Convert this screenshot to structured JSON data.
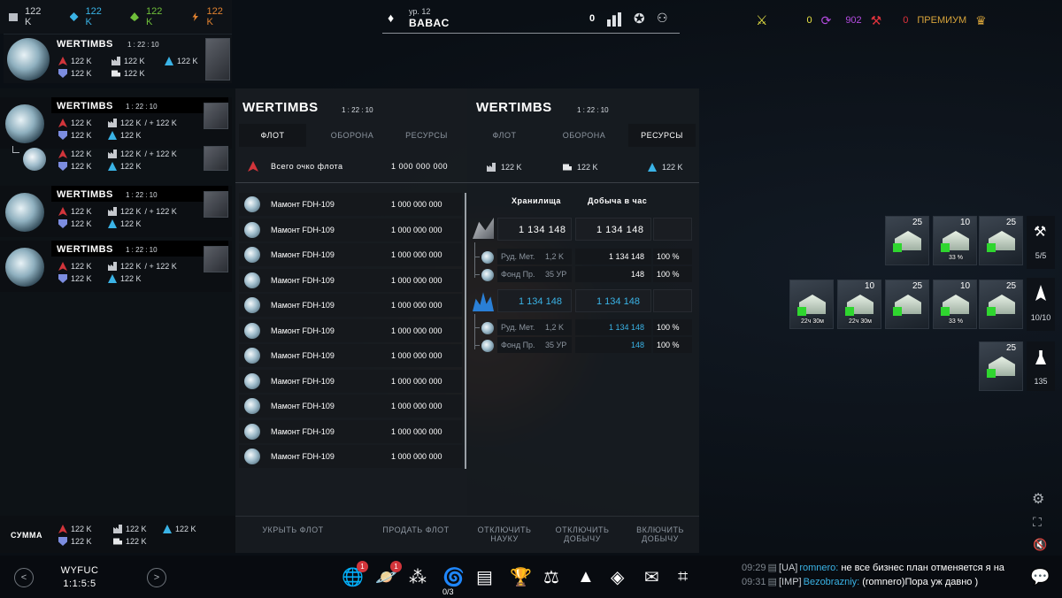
{
  "top_resources": [
    {
      "icon": "storage-icon",
      "value": "122 K",
      "color": "#c6c9ce"
    },
    {
      "icon": "crystal-icon",
      "value": "122 K",
      "color": "#3ab3e6"
    },
    {
      "icon": "deuterium-icon",
      "value": "122 K",
      "color": "#6fbf3a"
    },
    {
      "icon": "energy-icon",
      "value": "122 K",
      "color": "#e0812f"
    }
  ],
  "player": {
    "level": "ур. 12",
    "name": "BABAC",
    "rank": "0"
  },
  "top_right": {
    "val1": "0",
    "val2": "902",
    "val3": "0",
    "premium": "ПРЕМИУМ"
  },
  "planet_card_top": {
    "name": "WERTIMBS",
    "time": "1 : 22 : 10",
    "r1": "122 K",
    "r2": "122 K",
    "r3": "122 K",
    "r4": "122 K",
    "r5": "122 K"
  },
  "planet_list": [
    {
      "name": "WERTIMBS",
      "time": "1 : 22 : 10",
      "a": "122 K",
      "b": "122 K",
      "b_plus": "/ + 122 K",
      "c": "122 K",
      "d": "122 K"
    },
    {
      "name": "",
      "time": "",
      "a": "122 K",
      "b": "122 K",
      "b_plus": "/ + 122 K",
      "c": "122 K",
      "d": "122 K"
    },
    {
      "name": "WERTIMBS",
      "time": "1 : 22 : 10",
      "a": "122 K",
      "b": "122 K",
      "b_plus": "/ + 122 K",
      "c": "122 K",
      "d": "122 K"
    },
    {
      "name": "WERTIMBS",
      "time": "1 : 22 : 10",
      "a": "122 K",
      "b": "122 K",
      "b_plus": "/ + 122 K",
      "c": "122 K",
      "d": "122 K"
    }
  ],
  "sum": {
    "label": "СУММА",
    "a": "122 K",
    "b": "122 K",
    "c": "122 K",
    "d": "122 K",
    "e": "122 K"
  },
  "fleet_panel": {
    "title": "WERTIMBS",
    "time": "1 : 22 : 10",
    "tabs": [
      "ФЛОТ",
      "ОБОРОНА",
      "РЕСУРСЫ"
    ],
    "total_label": "Всего очко флота",
    "total_value": "1 000 000 000",
    "ships": [
      {
        "name": "Мамонт FDH-109",
        "value": "1 000 000 000"
      },
      {
        "name": "Мамонт FDH-109",
        "value": "1 000 000 000"
      },
      {
        "name": "Мамонт FDH-109",
        "value": "1 000 000 000"
      },
      {
        "name": "Мамонт FDH-109",
        "value": "1 000 000 000"
      },
      {
        "name": "Мамонт FDH-109",
        "value": "1 000 000 000"
      },
      {
        "name": "Мамонт FDH-109",
        "value": "1 000 000 000"
      },
      {
        "name": "Мамонт FDH-109",
        "value": "1 000 000 000"
      },
      {
        "name": "Мамонт FDH-109",
        "value": "1 000 000 000"
      },
      {
        "name": "Мамонт FDH-109",
        "value": "1 000 000 000"
      },
      {
        "name": "Мамонт FDH-109",
        "value": "1 000 000 000"
      },
      {
        "name": "Мамонт FDH-109",
        "value": "1 000 000 000"
      }
    ]
  },
  "res_panel": {
    "title": "WERTIMBS",
    "time": "1 : 22 : 10",
    "tabs": [
      "ФЛОТ",
      "ОБОРОНА",
      "РЕСУРСЫ"
    ],
    "sum1": "122 K",
    "sum2": "122 K",
    "sum3": "122 K",
    "col1": "Хранилища",
    "col2": "Добыча в час",
    "metal": {
      "storage": "1 134 148",
      "prod": "1 134 148",
      "rows": [
        {
          "label": "Руд. Мет.",
          "level": "1,2 K",
          "val": "1 134 148",
          "pct": "100 %"
        },
        {
          "label": "Фонд Пр.",
          "level": "35 УР",
          "val": "148",
          "pct": "100 %"
        }
      ]
    },
    "crystal": {
      "storage": "1 134 148",
      "prod": "1 134 148",
      "rows": [
        {
          "label": "Руд. Мет.",
          "level": "1,2 K",
          "val": "1 134 148",
          "pct": "100 %"
        },
        {
          "label": "Фонд Пр.",
          "level": "35 УР",
          "val": "148",
          "pct": "100 %"
        }
      ]
    }
  },
  "bottom_buttons": [
    "УКРЫТЬ ФЛОТ",
    "ПРОДАТЬ ФЛОТ",
    "ОТКЛЮЧИТЬ НАУКУ",
    "ОТКЛЮЧИТЬ ДОБЫЧУ",
    "ВКЛЮЧИТЬ ДОБЫЧУ"
  ],
  "nav": {
    "name": "WYFUC",
    "coords": "1:1:5:5",
    "prev": "<",
    "next": ">"
  },
  "dock": {
    "badge1": "1",
    "badge2": "1",
    "counter": "0/3"
  },
  "chat": [
    {
      "time": "09:29",
      "tag": "[UA]",
      "user": "romnero:",
      "msg": "не все бизнес план отменяется я на"
    },
    {
      "time": "09:31",
      "tag": "[IMP]",
      "user": "Bezobrazniy:",
      "msg": "(romnero)Пора уж давно )"
    }
  ],
  "buildings": [
    {
      "level": "25",
      "label": ""
    },
    {
      "level": "10",
      "label": "33 %"
    },
    {
      "level": "25",
      "label": ""
    },
    {
      "level": "",
      "label": "22ч 30м"
    },
    {
      "level": "10",
      "label": "22ч 30м"
    },
    {
      "level": "25",
      "label": ""
    },
    {
      "level": "10",
      "label": "33 %"
    },
    {
      "level": "25",
      "label": ""
    },
    {
      "level": "25",
      "label": ""
    }
  ],
  "side_counters": [
    "5/5",
    "10/10",
    "135"
  ]
}
